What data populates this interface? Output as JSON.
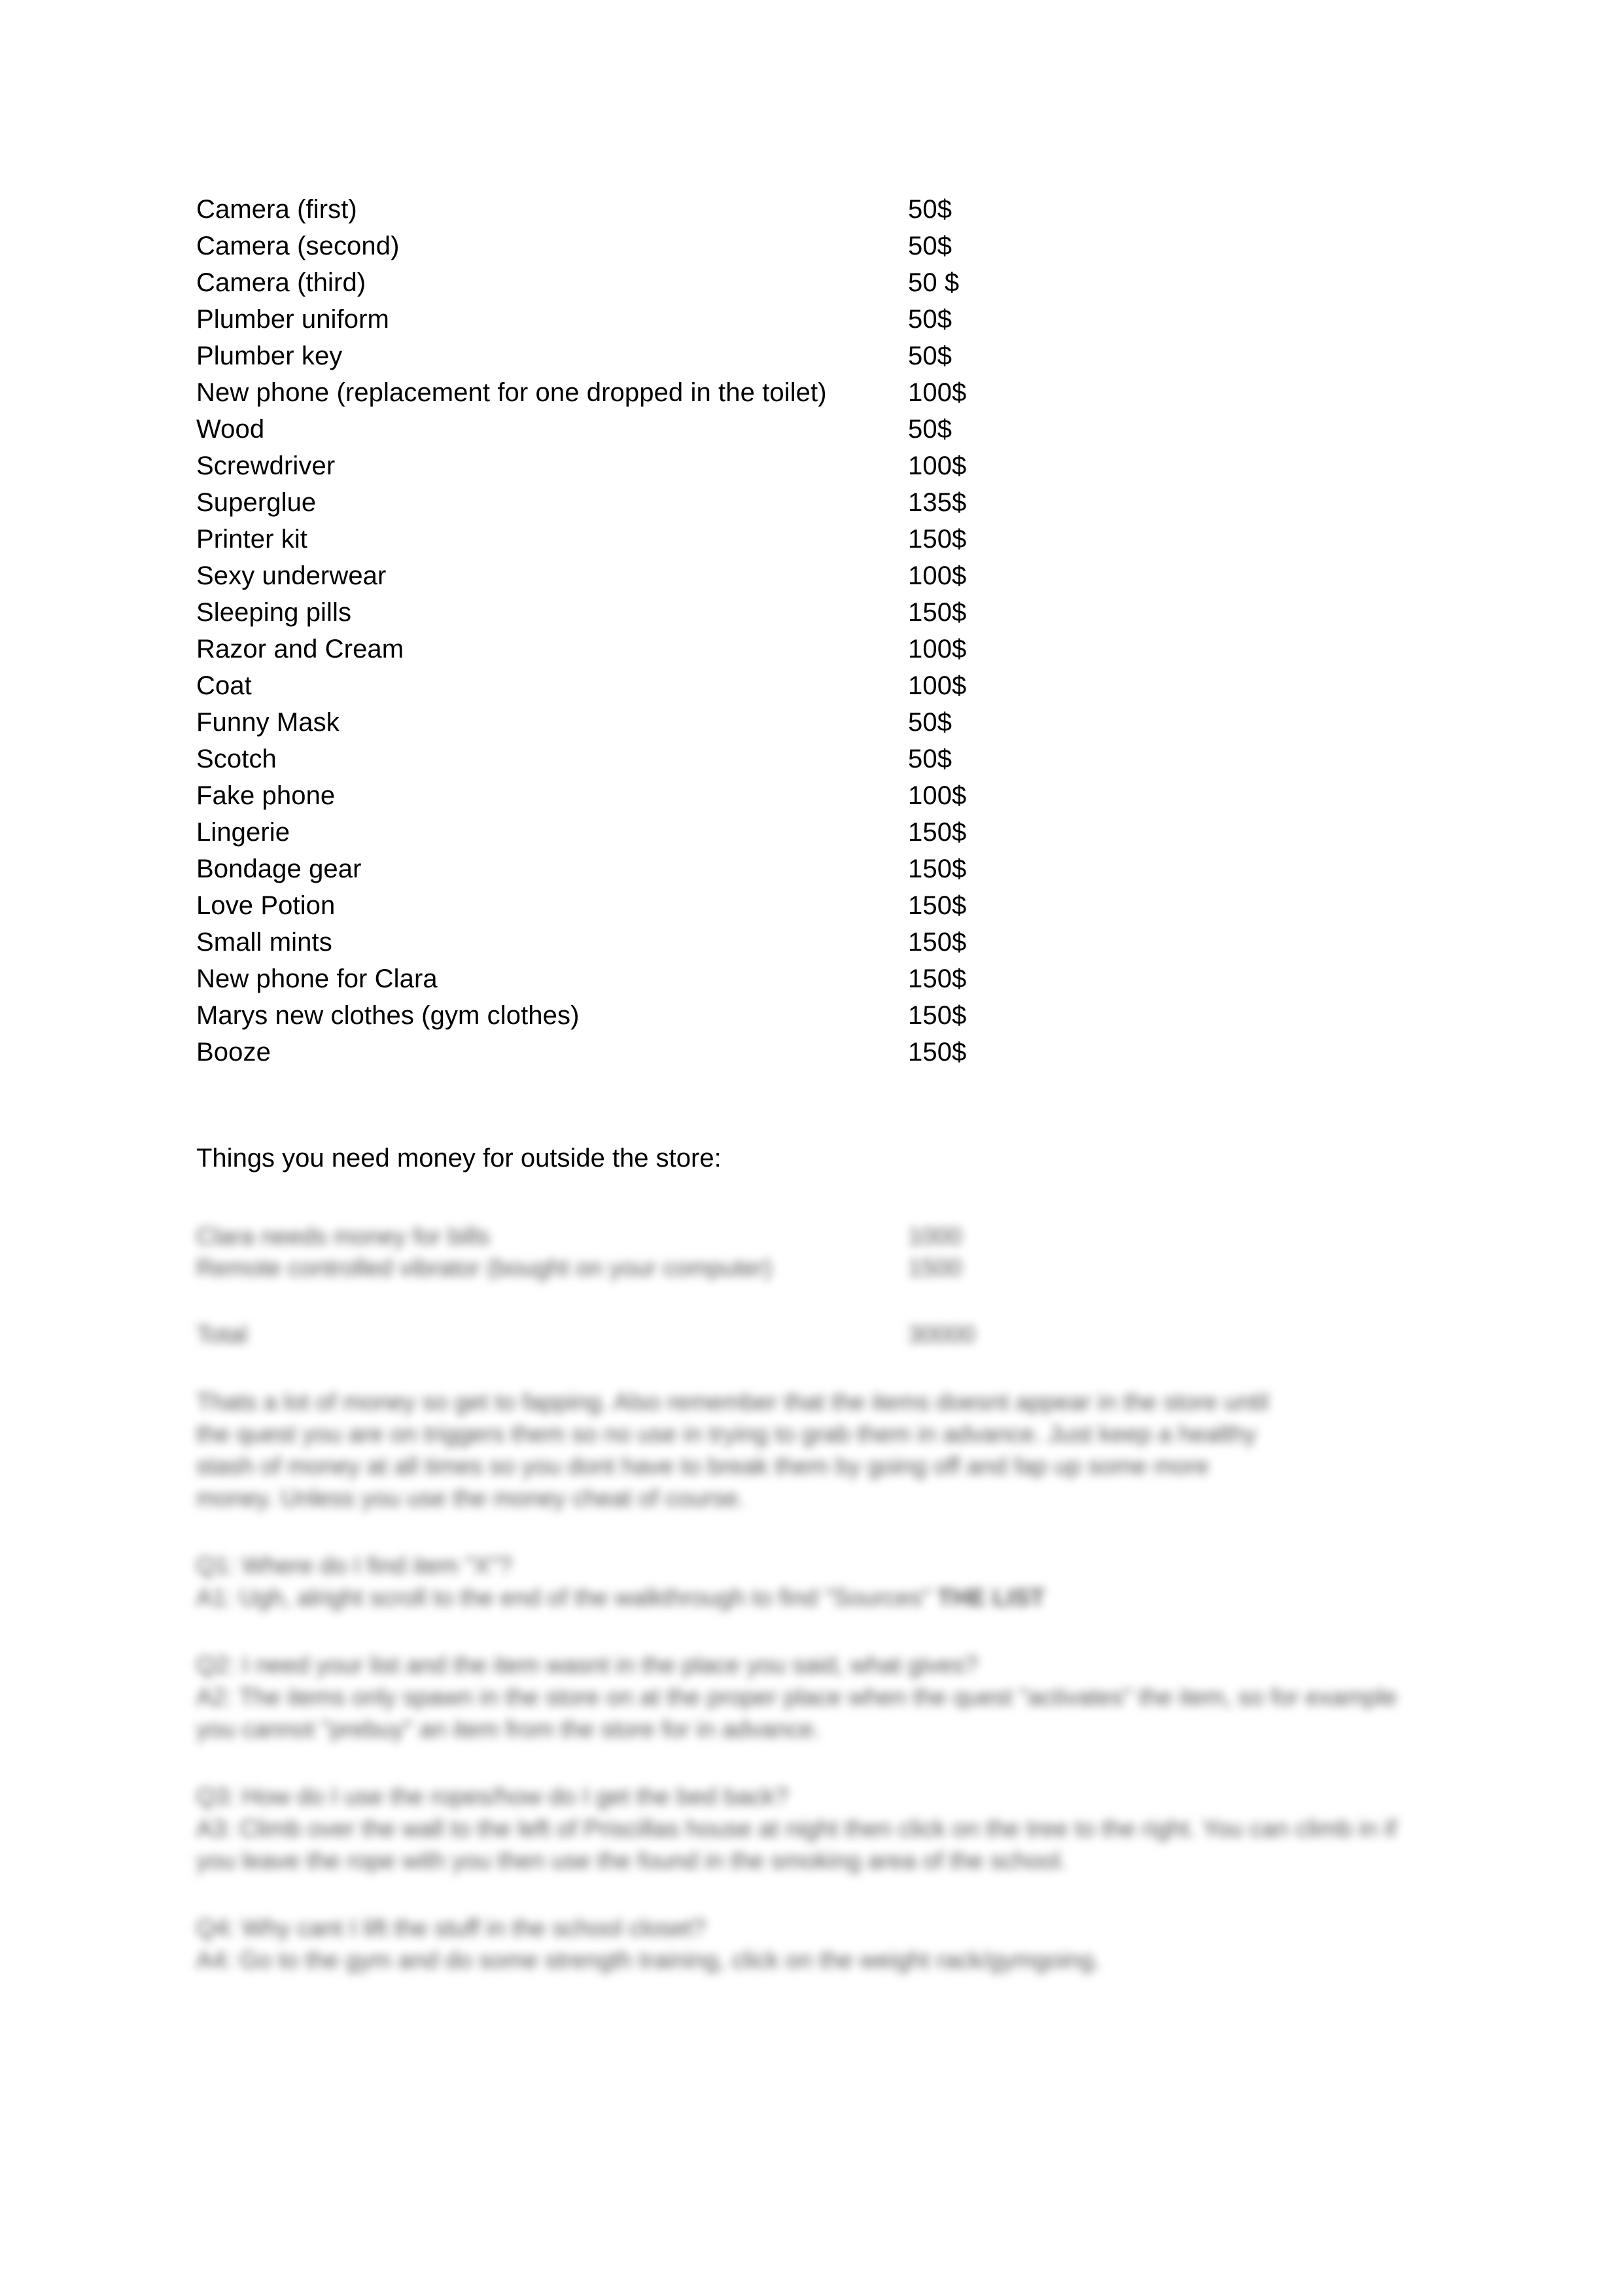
{
  "document": {
    "type": "price-list-document",
    "background_color": "#ffffff",
    "text_color": "#000000"
  },
  "store_list": {
    "items": [
      {
        "name": "Camera (first)",
        "price": "50$"
      },
      {
        "name": "Camera (second)",
        "price": "50$"
      },
      {
        "name": "Camera (third)",
        "price": "50 $"
      },
      {
        "name": "Plumber uniform",
        "price": "50$"
      },
      {
        "name": "Plumber key",
        "price": "50$"
      },
      {
        "name": "New phone (replacement for one dropped in the toilet)",
        "price": "100$"
      },
      {
        "name": "Wood",
        "price": "50$"
      },
      {
        "name": "Screwdriver",
        "price": "100$"
      },
      {
        "name": "Superglue",
        "price": "135$"
      },
      {
        "name": "Printer kit",
        "price": "150$"
      },
      {
        "name": "Sexy underwear",
        "price": "100$"
      },
      {
        "name": "Sleeping pills",
        "price": "150$"
      },
      {
        "name": "Razor and Cream",
        "price": "100$"
      },
      {
        "name": "Coat",
        "price": "100$"
      },
      {
        "name": "Funny Mask",
        "price": "50$"
      },
      {
        "name": "Scotch",
        "price": "50$"
      },
      {
        "name": "Fake phone",
        "price": "100$"
      },
      {
        "name": "Lingerie",
        "price": "150$"
      },
      {
        "name": "Bondage gear",
        "price": "150$"
      },
      {
        "name": "Love Potion",
        "price": "150$"
      },
      {
        "name": "Small mints",
        "price": "150$"
      },
      {
        "name": "New phone for Clara",
        "price": "150$"
      },
      {
        "name": "Marys new clothes (gym clothes)",
        "price": "150$"
      },
      {
        "name": "Booze",
        "price": "150$"
      }
    ]
  },
  "outside_section": {
    "heading": "Things you need money for outside the store:",
    "items": [
      {
        "name": "Clara needs money for bills",
        "price": "1000"
      },
      {
        "name": "Remote controlled vibrator (bought on your computer)",
        "price": "1500"
      }
    ],
    "total": {
      "label": "Total",
      "price": "30000"
    }
  },
  "notes": {
    "paragraph_lines": [
      "Thats a lot of money so get to fapping. Also remember that the items doesnt appear in the store until",
      "the quest you are on triggers them so no use in trying to grab them in advance. Just keep a healthy",
      "stash of money at all times so you dont have to break them by going off and fap up some more",
      "money. Unless you use the money cheat of course."
    ]
  },
  "qa": [
    {
      "question": "Q1: Where do I find item \"X\"?",
      "answer_prefix": "A1: Ugh, alright scroll to the end of the walkthrough to find \"Sources\"",
      "answer_strong": "THE LIST"
    },
    {
      "question": "Q2: I need your list and the item wasnt in the place you said, what gives?",
      "answer": "A2: The items only spawn in the store on at the proper place when the quest \"activates\" the item, so for example you cannot \"prebuy\" an item from the store for in advance."
    },
    {
      "question": "Q3: How do I use the ropes/how do I get the bed back?",
      "answer": "A3: Climb over the wall to the left of Priscillas house at night then click on the tree to the right. You can climb in if you leave the rope with you then use the found in the smoking area of the school."
    },
    {
      "question": "Q4: Why cant I lift the stuff in the school closet?",
      "answer": "A4: Go to the gym and do some strength training, click on the weight rack/gymgoing."
    }
  ]
}
